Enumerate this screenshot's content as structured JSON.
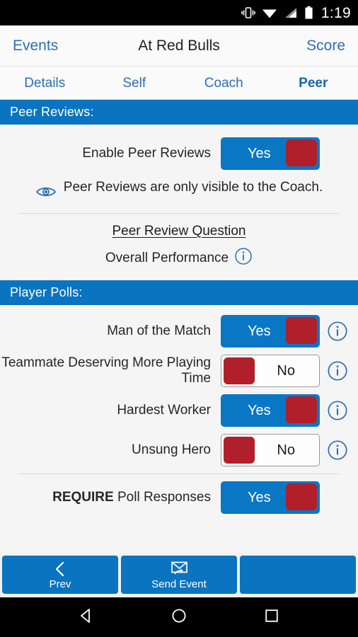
{
  "statusbar": {
    "time": "1:19",
    "icons": [
      "vibrate-icon",
      "wifi-icon",
      "signal-icon",
      "battery-icon"
    ]
  },
  "appbar": {
    "back_label": "Events",
    "title": "At Red Bulls",
    "action_label": "Score"
  },
  "tabs": [
    {
      "label": "Details",
      "active": false
    },
    {
      "label": "Self",
      "active": false
    },
    {
      "label": "Coach",
      "active": false
    },
    {
      "label": "Peer",
      "active": true
    }
  ],
  "peer_reviews": {
    "header": "Peer Reviews:",
    "enable_row": {
      "label": "Enable Peer Reviews",
      "value": "Yes",
      "state": "on"
    },
    "note": "Peer Reviews are only visible to the Coach.",
    "question_title": "Peer Review Question",
    "question_value": "Overall Performance"
  },
  "player_polls": {
    "header": "Player Polls:",
    "rows": [
      {
        "label": "Man of the Match",
        "value": "Yes",
        "state": "on"
      },
      {
        "label": "Teammate Deserving More Playing Time",
        "value": "No",
        "state": "off"
      },
      {
        "label": "Hardest Worker",
        "value": "Yes",
        "state": "on"
      },
      {
        "label": "Unsung Hero",
        "value": "No",
        "state": "off"
      }
    ],
    "require_row": {
      "label_bold": "REQUIRE",
      "label_rest": " Poll Responses",
      "value": "Yes",
      "state": "on"
    }
  },
  "bottom_buttons": [
    {
      "label": "Prev",
      "icon": "chevron-left-icon"
    },
    {
      "label": "Send Event",
      "icon": "send-mail-icon"
    },
    {
      "label": "",
      "icon": ""
    }
  ],
  "android_nav": [
    "back-icon",
    "home-icon",
    "recents-icon"
  ],
  "colors": {
    "accent_blue": "#0a74c0",
    "toggle_blue": "#0a77c5",
    "thumb_red": "#b01f2a",
    "link_blue": "#2d6fb5",
    "page_bg": "#f5f5f5"
  }
}
